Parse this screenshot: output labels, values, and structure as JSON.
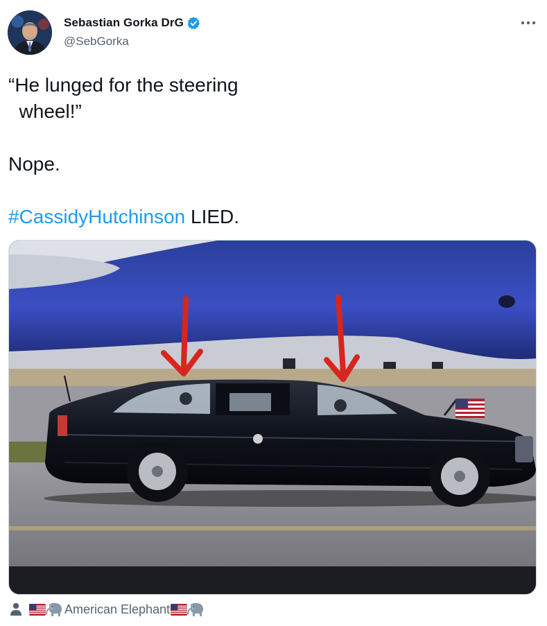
{
  "user": {
    "display_name": "Sebastian Gorka DrG",
    "handle": "@SebGorka",
    "verified": true
  },
  "icons": {
    "more": "more-horizontal-icon",
    "verified": "verified-badge-icon",
    "person": "person-icon",
    "flag": "us-flag-icon",
    "elephant": "elephant-icon"
  },
  "tweet": {
    "line1": "“He lunged for the steering",
    "line2": "  wheel!”",
    "line3": "Nope.",
    "hashtag": "#CassidyHutchinson",
    "line4_rest": " LIED."
  },
  "media": {
    "alt": "Presidential limousine on an airport tarmac with two red arrows pointing at the car windows"
  },
  "footer": {
    "tagged_user": "American Elephant"
  },
  "colors": {
    "link": "#1d9bf0",
    "verified": "#1d9bf0",
    "arrow": "#d7261e",
    "secondary_text": "#536471"
  }
}
